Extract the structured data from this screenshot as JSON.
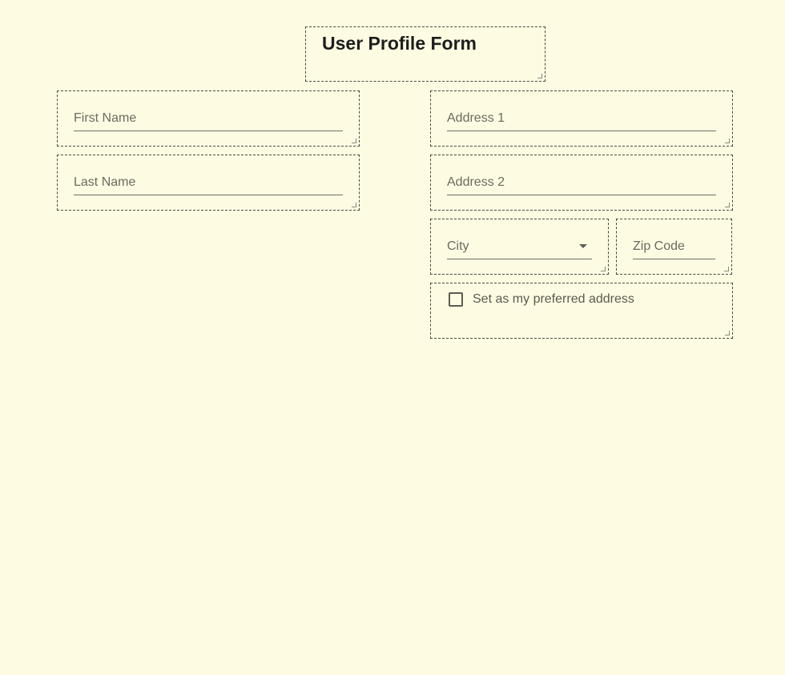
{
  "form": {
    "title": "User Profile Form",
    "first_name": {
      "placeholder": "First Name",
      "value": ""
    },
    "last_name": {
      "placeholder": "Last Name",
      "value": ""
    },
    "address1": {
      "placeholder": "Address 1",
      "value": ""
    },
    "address2": {
      "placeholder": "Address 2",
      "value": ""
    },
    "city": {
      "placeholder": "City",
      "selected": "City",
      "icon": "chevron-down-icon"
    },
    "zip": {
      "placeholder": "Zip Code",
      "value": ""
    },
    "preferred": {
      "label": "Set as my preferred address",
      "checked": false
    }
  },
  "colors": {
    "background": "#fdfce2",
    "border": "#4a4a40",
    "text": "#1f1f1f",
    "placeholder": "#6b6b60"
  }
}
